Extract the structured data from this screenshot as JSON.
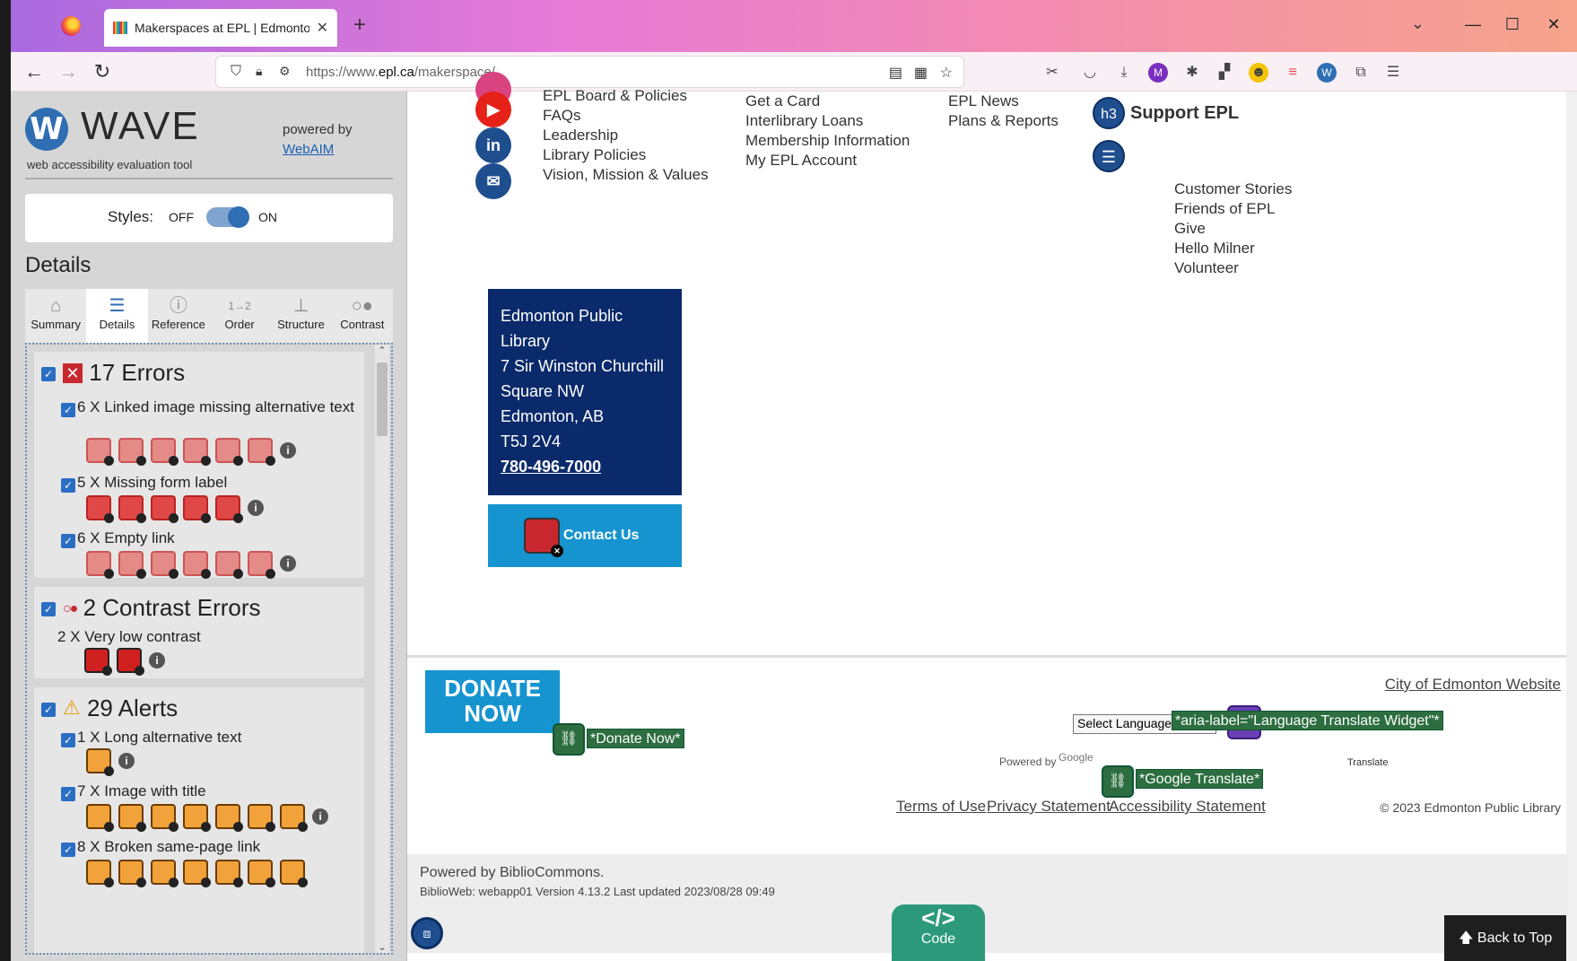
{
  "browser": {
    "tab_title": "Makerspaces at EPL | Edmonton",
    "url_prefix": "https://www.",
    "url_domain": "epl.ca",
    "url_path": "/makerspace/",
    "new_tab_label": "+",
    "close_tab_label": "✕"
  },
  "wave": {
    "title": "WAVE",
    "subtitle": "web accessibility evaluation tool",
    "powered_by": "powered by",
    "webaim": "WebAIM",
    "styles_label": "Styles:",
    "styles_off": "OFF",
    "styles_on": "ON",
    "details_heading": "Details",
    "tabs": [
      {
        "label": "Summary",
        "icon": "home-icon"
      },
      {
        "label": "Details",
        "icon": "list-icon"
      },
      {
        "label": "Reference",
        "icon": "info-icon"
      },
      {
        "label": "Order",
        "icon": "order-icon"
      },
      {
        "label": "Structure",
        "icon": "structure-icon"
      },
      {
        "label": "Contrast",
        "icon": "contrast-icon"
      }
    ],
    "errors": {
      "title": "17 Errors",
      "items": [
        {
          "label": "6 X Linked image missing alternative text",
          "count": 6
        },
        {
          "label": "5 X Missing form label",
          "count": 5
        },
        {
          "label": "6 X Empty link",
          "count": 6
        }
      ]
    },
    "contrast": {
      "title": "2 Contrast Errors",
      "items": [
        {
          "label": "2 X Very low contrast",
          "count": 2
        }
      ]
    },
    "alerts": {
      "title": "29 Alerts",
      "items": [
        {
          "label": "1 X Long alternative text",
          "count": 1
        },
        {
          "label": "7 X Image with title",
          "count": 7
        },
        {
          "label": "8 X Broken same-page link",
          "count": 8
        }
      ]
    }
  },
  "page": {
    "col1": [
      "EPL Board & Policies",
      "FAQs",
      "Leadership",
      "Library Policies",
      "Vision, Mission & Values"
    ],
    "col2": [
      "Get a Card",
      "Interlibrary Loans",
      "Membership Information",
      "My EPL Account"
    ],
    "col3": [
      "EPL News",
      "Plans & Reports"
    ],
    "support_h3": "h3",
    "support_title": "Support EPL",
    "col4": [
      "Customer Stories",
      "Friends of EPL",
      "Give",
      "Hello Milner",
      "Volunteer"
    ],
    "address": [
      "Edmonton Public",
      "Library",
      "7 Sir Winston Churchill",
      "Square NW",
      "Edmonton, AB",
      "T5J 2V4"
    ],
    "phone": "780-496-7000",
    "contact_label": "Contact Us",
    "donate_line1": "DONATE",
    "donate_line2": "NOW",
    "donate_label": "*Donate Now*",
    "city_link": "City of Edmonton Website",
    "select_language": "Select Language",
    "aria_label": "*aria-label=\"Language Translate Widget\"*",
    "powered_by": "Powered by",
    "google": "Google",
    "google_translate": "*Google Translate*",
    "translate": "Translate",
    "terms": "Terms of Use",
    "privacy": "Privacy Statement",
    "accessibility": "Accessibility Statement",
    "copyright": "© 2023 Edmonton Public Library",
    "biblio1": "Powered by BiblioCommons.",
    "biblio2": "BiblioWeb: webapp01 Version 4.13.2 Last updated 2023/08/28 09:49",
    "code_symbol": "</>",
    "code_label": "Code",
    "back_to_top": "Back to Top"
  },
  "colors": {
    "wave_blue": "#2f6eb3",
    "epl_navy": "#0b2a6b",
    "epl_cyan": "#1694d0",
    "error_red": "#c8272e",
    "alert_orange": "#f1a23a"
  }
}
